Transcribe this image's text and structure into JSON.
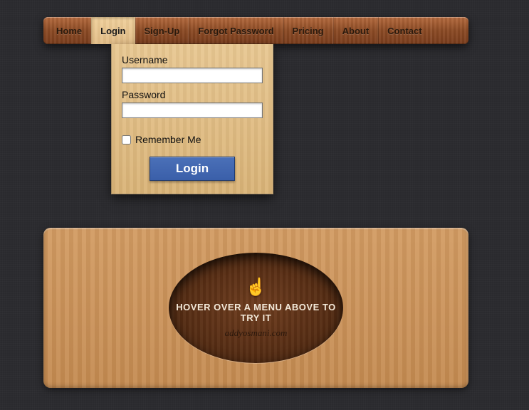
{
  "nav": {
    "items": [
      {
        "label": "Home"
      },
      {
        "label": "Login"
      },
      {
        "label": "Sign-Up"
      },
      {
        "label": "Forgot Password"
      },
      {
        "label": "Pricing"
      },
      {
        "label": "About"
      },
      {
        "label": "Contact"
      }
    ],
    "activeIndex": 1
  },
  "login": {
    "usernameLabel": "Username",
    "passwordLabel": "Password",
    "rememberLabel": "Remember Me",
    "submitLabel": "Login"
  },
  "footer": {
    "hoverText": "Hover over a menu above to try it",
    "credit": "addyosmani.com"
  }
}
